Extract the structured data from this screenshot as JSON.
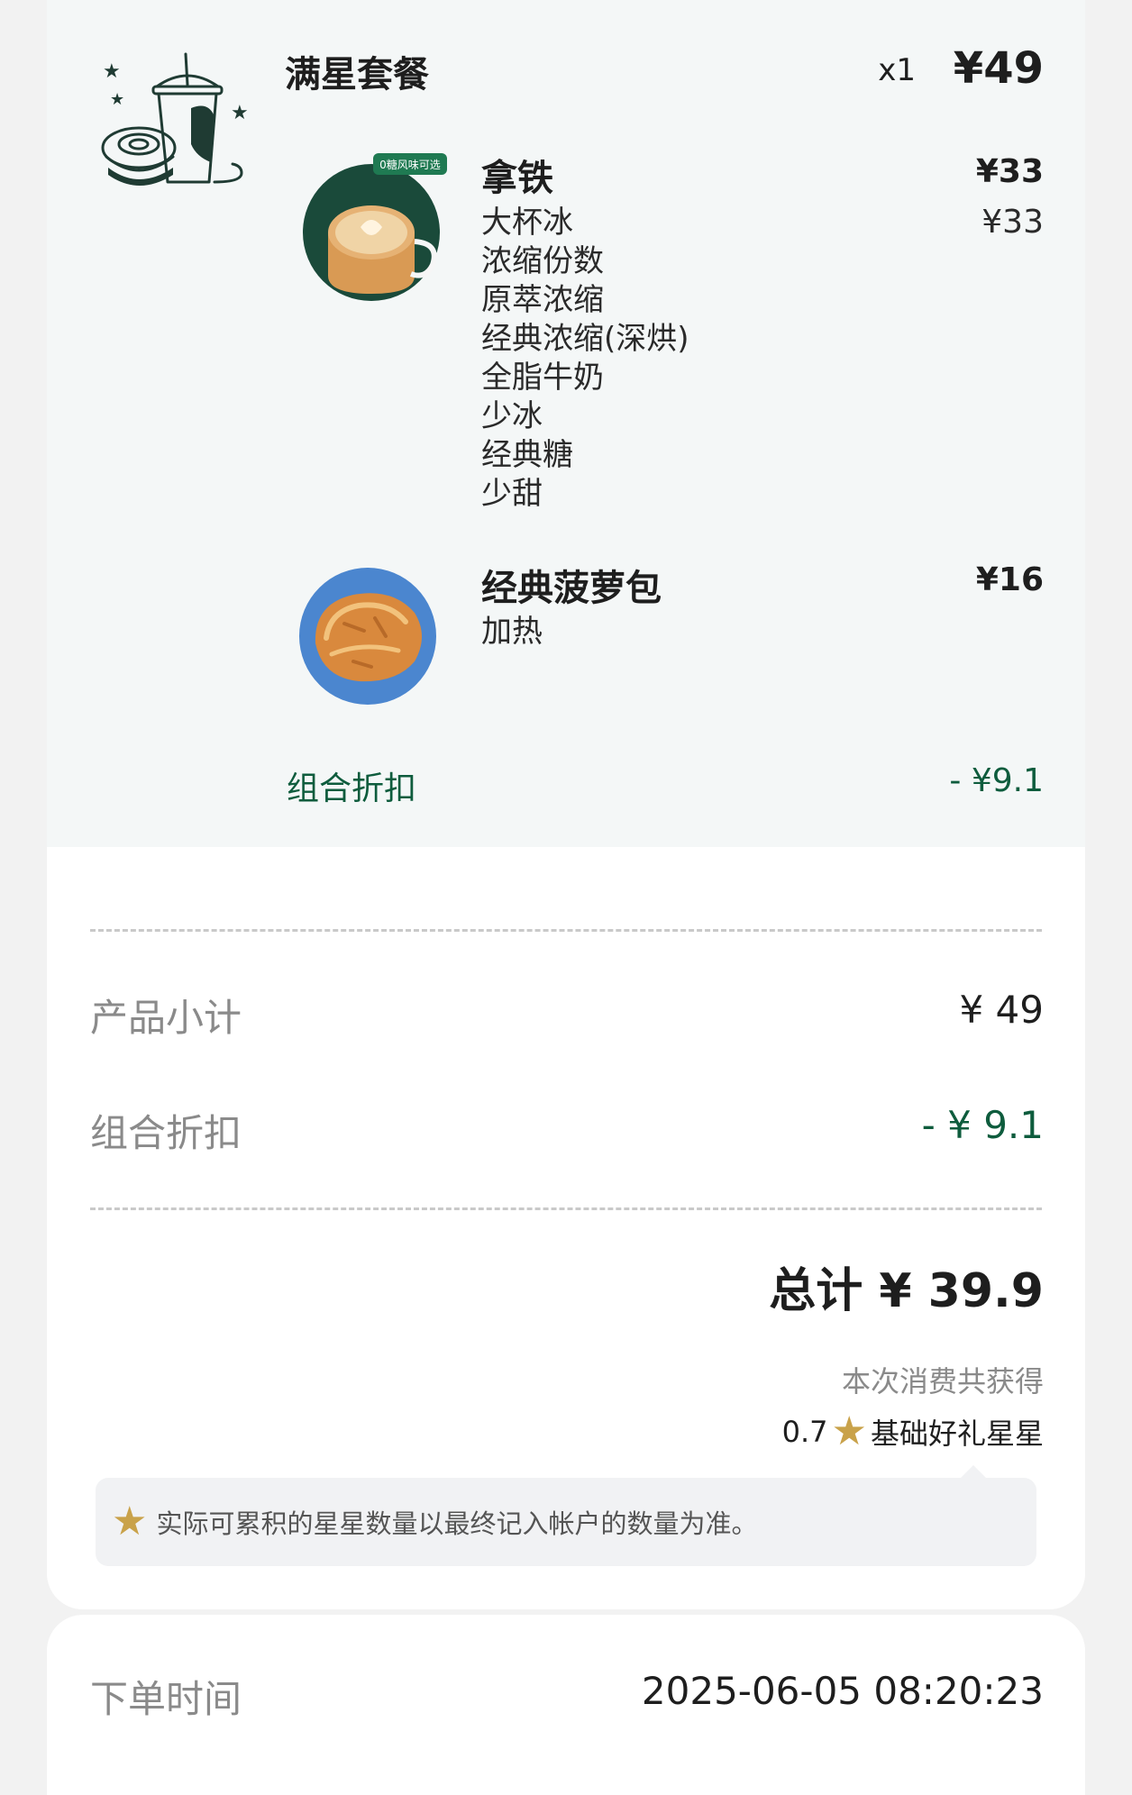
{
  "combo": {
    "title": "满星套餐",
    "quantity": "x1",
    "price": "¥49",
    "image_icon": "combo-drink-bagel-icon"
  },
  "items": [
    {
      "name": "拿铁",
      "price": "¥33",
      "badge": "0糖风味可选",
      "options": [
        "大杯冰",
        "浓缩份数",
        "原萃浓缩",
        "经典浓缩(深烘)",
        "全脂牛奶",
        "少冰",
        "经典糖",
        "少甜"
      ],
      "option_price": "¥33"
    },
    {
      "name": "经典菠萝包",
      "price": "¥16",
      "options": [
        "加热"
      ]
    }
  ],
  "combo_discount": {
    "label": "组合折扣",
    "value": "- ¥9.1"
  },
  "summary": {
    "subtotal_label": "产品小计",
    "subtotal_value": "¥ 49",
    "discount_label": "组合折扣",
    "discount_value": "- ¥ 9.1",
    "total": "总计 ¥ 39.9"
  },
  "stars": {
    "note": "本次消费共获得",
    "amount": "0.7",
    "label": "基础好礼星星",
    "tip": "实际可累积的星星数量以最终记入帐户的数量为准。"
  },
  "order": {
    "time_label": "下单时间",
    "time_value": "2025-06-05 08:20:23"
  },
  "colors": {
    "accent_green": "#0e5c3d",
    "star_gold": "#c9a24a"
  }
}
